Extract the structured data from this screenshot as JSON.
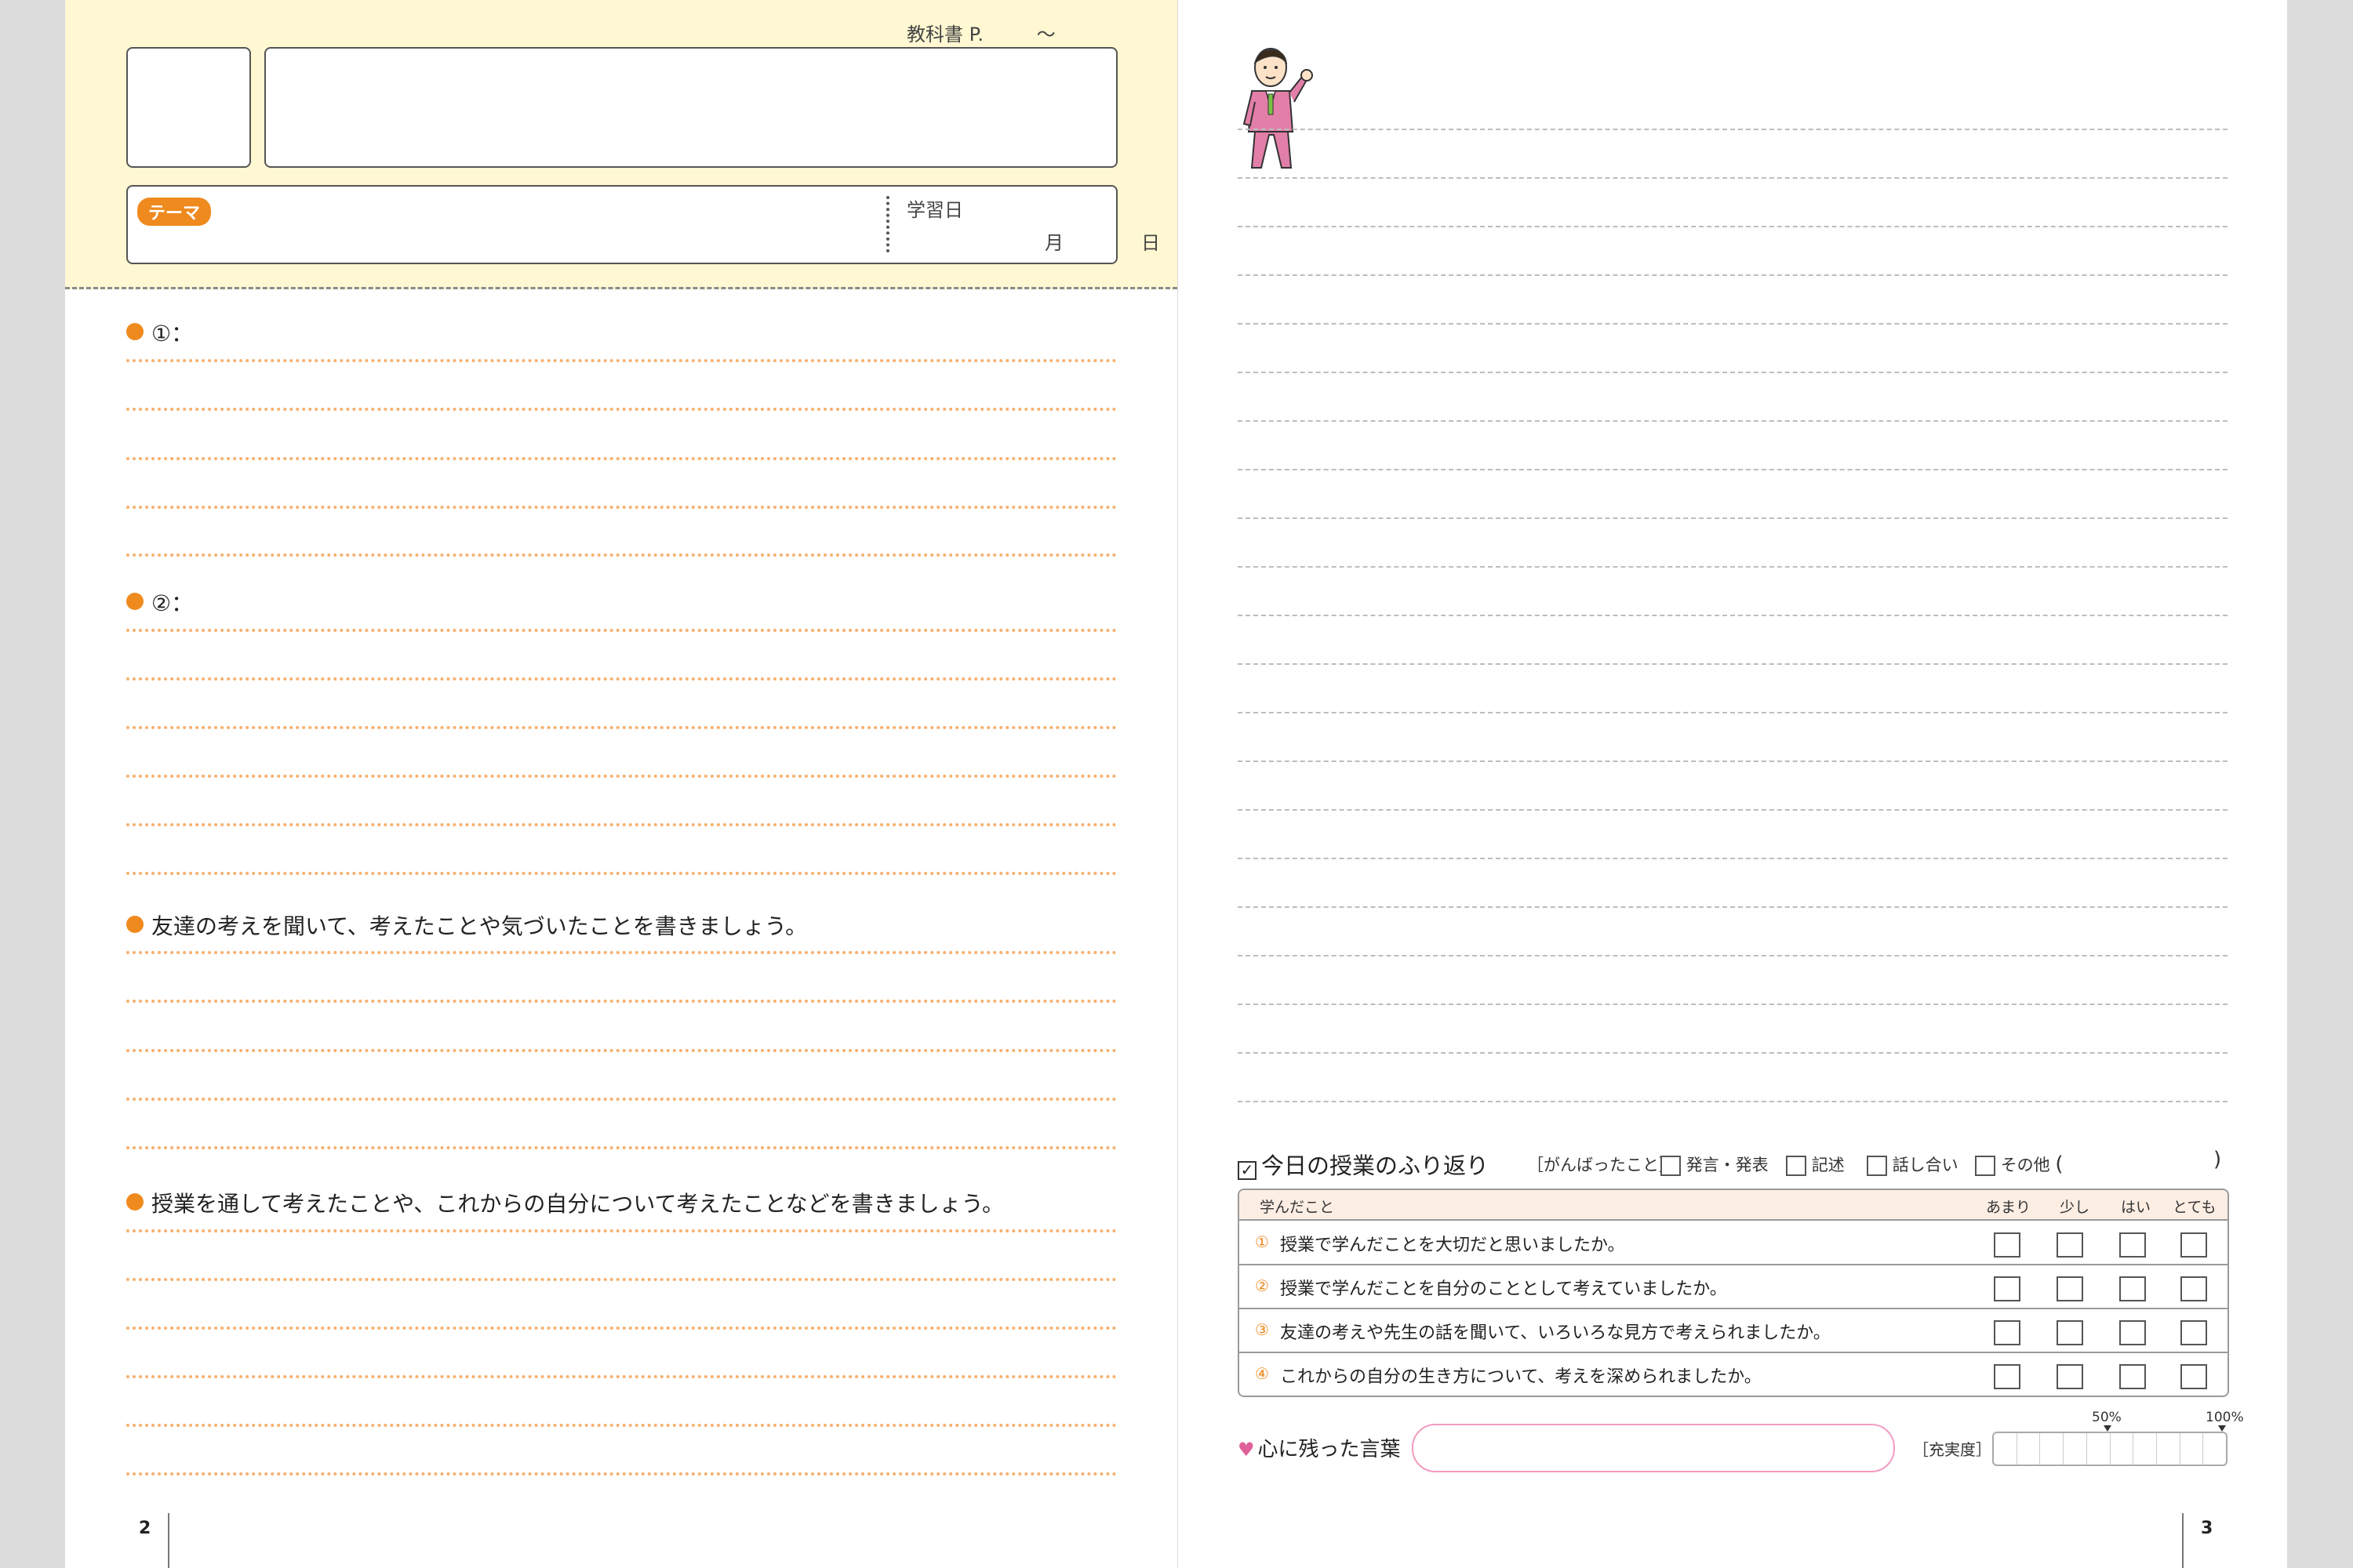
{
  "header": {
    "textbook_ref": "教科書 P.",
    "tilde": "〜",
    "theme_label": "テーマ",
    "study_date_label": "学習日",
    "month_label": "月",
    "day_label": "日"
  },
  "questions": {
    "q1": "①：",
    "q2": "②：",
    "q3": "友達の考えを聞いて、考えたことや気づいたことを書きましょう。",
    "q4": "授業を通して考えたことや、これからの自分について考えたことなどを書きましょう。"
  },
  "page_numbers": {
    "left": "2",
    "right": "3"
  },
  "reflection": {
    "title": "今日の授業のふり返り",
    "effort_label": "［がんばったこと］",
    "effort_options": [
      "発言・発表",
      "記述",
      "話し合い",
      "その他"
    ],
    "other_open": "(",
    "other_close": ")",
    "table_header": "学んだこと",
    "scale": [
      "あまり",
      "少し",
      "はい",
      "とても"
    ],
    "rows": [
      {
        "num": "①",
        "text": "授業で学んだことを大切だと思いましたか。"
      },
      {
        "num": "②",
        "text": "授業で学んだことを自分のこととして考えていましたか。"
      },
      {
        "num": "③",
        "text": "友達の考えや先生の話を聞いて、いろいろな見方で考えられましたか。"
      },
      {
        "num": "④",
        "text": "これからの自分の生き方について、考えを深められましたか。"
      }
    ]
  },
  "memorable": {
    "label": "心に残った言葉"
  },
  "fulfillment": {
    "label": "［充実度］",
    "mark_mid": "50%",
    "mark_end": "100%"
  },
  "colors": {
    "accent": "#ef8a1f",
    "header_bg": "#fff8d2",
    "heart": "#e0609b",
    "dotted": "#f6b06f"
  },
  "icons": [
    "teacher-character-illustration",
    "heart-icon",
    "checkbox-icon"
  ]
}
